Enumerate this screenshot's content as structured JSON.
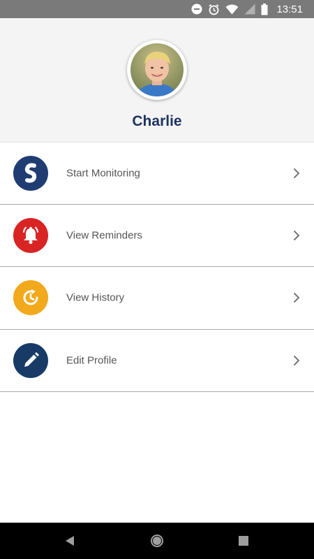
{
  "status_bar": {
    "time": "13:51",
    "icons": [
      "do-not-disturb-icon",
      "alarm-icon",
      "wifi-icon",
      "cell-signal-icon",
      "battery-icon"
    ],
    "background": "#7a7a7a"
  },
  "profile": {
    "name": "Charlie",
    "avatar_icon": "child-avatar",
    "name_color": "#1d3461",
    "header_background": "#f4f4f4"
  },
  "menu": {
    "items": [
      {
        "label": "Start Monitoring",
        "icon": "monitoring-s-icon",
        "color": "#1f3d73"
      },
      {
        "label": "View Reminders",
        "icon": "bell-icon",
        "color": "#d92424"
      },
      {
        "label": "View History",
        "icon": "history-icon",
        "color": "#f2a91c"
      },
      {
        "label": "Edit Profile",
        "icon": "pencil-icon",
        "color": "#183a66"
      }
    ]
  },
  "nav_bar": {
    "buttons": [
      "back-icon",
      "home-icon",
      "recents-icon"
    ]
  }
}
